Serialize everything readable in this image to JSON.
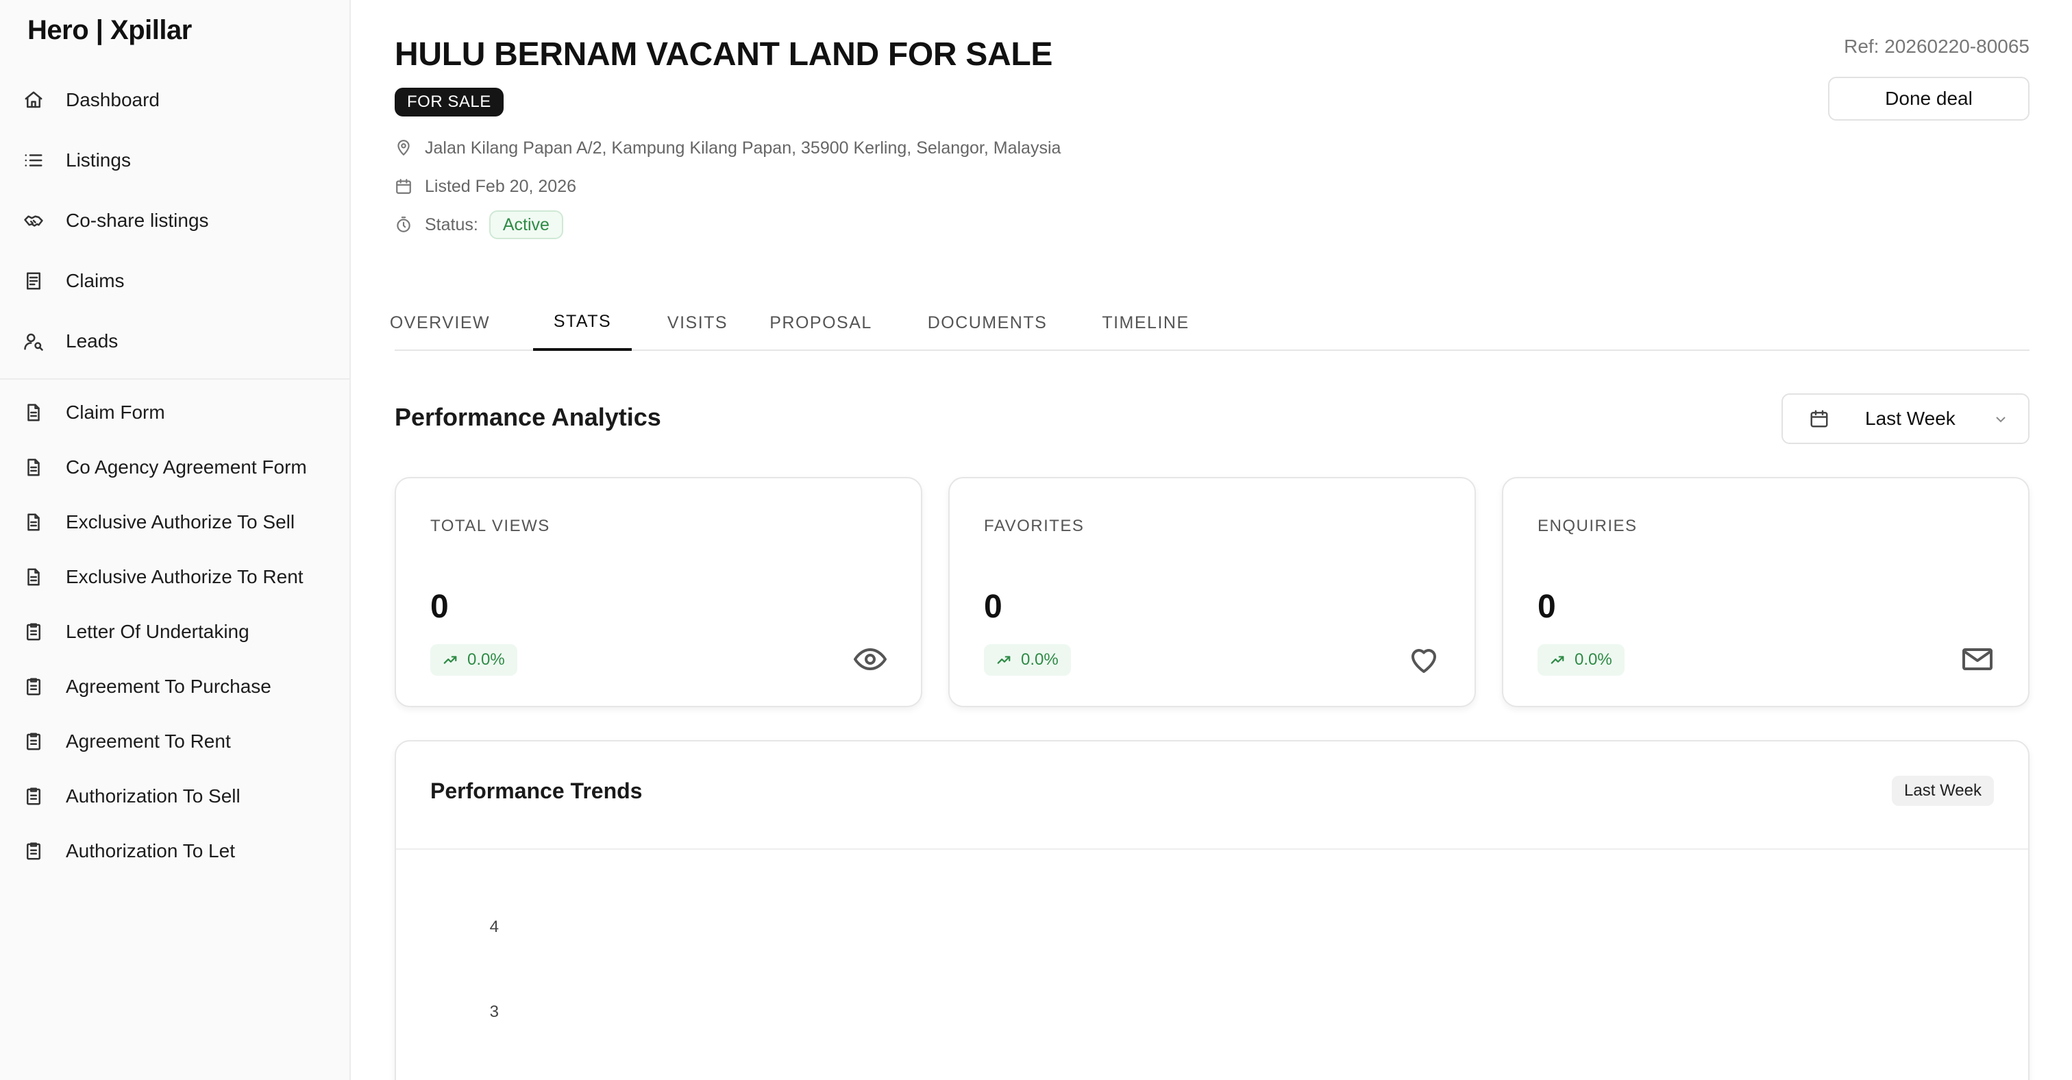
{
  "sidebar": {
    "brand": "Hero | Xpillar",
    "items": [
      {
        "label": "Dashboard",
        "icon": "home-icon"
      },
      {
        "label": "Listings",
        "icon": "list-icon"
      },
      {
        "label": "Co-share listings",
        "icon": "handshake-icon"
      },
      {
        "label": "Claims",
        "icon": "receipt-icon"
      },
      {
        "label": "Leads",
        "icon": "user-search-icon"
      }
    ],
    "forms": [
      {
        "label": "Claim Form",
        "icon": "document-icon"
      },
      {
        "label": "Co Agency Agreement Form",
        "icon": "document-icon"
      },
      {
        "label": "Exclusive Authorize To Sell",
        "icon": "document-icon"
      },
      {
        "label": "Exclusive Authorize To Rent",
        "icon": "document-icon"
      },
      {
        "label": "Letter Of Undertaking",
        "icon": "clipboard-icon"
      },
      {
        "label": "Agreement To Purchase",
        "icon": "clipboard-icon"
      },
      {
        "label": "Agreement To Rent",
        "icon": "clipboard-icon"
      },
      {
        "label": "Authorization To Sell",
        "icon": "clipboard-icon"
      },
      {
        "label": "Authorization To Let",
        "icon": "clipboard-icon"
      }
    ]
  },
  "listing": {
    "title": "HULU BERNAM VACANT LAND FOR SALE",
    "badge": "FOR SALE",
    "ref": "Ref: 20260220-80065",
    "done_label": "Done deal",
    "address": "Jalan Kilang Papan A/2, Kampung Kilang Papan, 35900 Kerling, Selangor, Malaysia",
    "listed": "Listed Feb 20, 2026",
    "status_label": "Status:",
    "status_value": "Active"
  },
  "tabs": [
    {
      "label": "OVERVIEW",
      "active": false
    },
    {
      "label": "STATS",
      "active": true
    },
    {
      "label": "VISITS",
      "active": false
    },
    {
      "label": "PROPOSAL",
      "active": false
    },
    {
      "label": "DOCUMENTS",
      "active": false
    },
    {
      "label": "TIMELINE",
      "active": false
    }
  ],
  "analytics": {
    "title": "Performance Analytics",
    "range": "Last Week",
    "cards": [
      {
        "label": "TOTAL VIEWS",
        "value": "0",
        "change": "0.0%",
        "icon": "eye-icon"
      },
      {
        "label": "FAVORITES",
        "value": "0",
        "change": "0.0%",
        "icon": "heart-icon"
      },
      {
        "label": "ENQUIRIES",
        "value": "0",
        "change": "0.0%",
        "icon": "mail-icon"
      }
    ]
  },
  "trends": {
    "title": "Performance Trends",
    "badge": "Last Week"
  },
  "chart_data": {
    "type": "line",
    "title": "Performance Trends",
    "y_ticks": [
      "4",
      "3"
    ],
    "series": []
  },
  "colors": {
    "accent": "#111111",
    "success": "#2e8b45",
    "success_bg": "#eef8f1"
  }
}
